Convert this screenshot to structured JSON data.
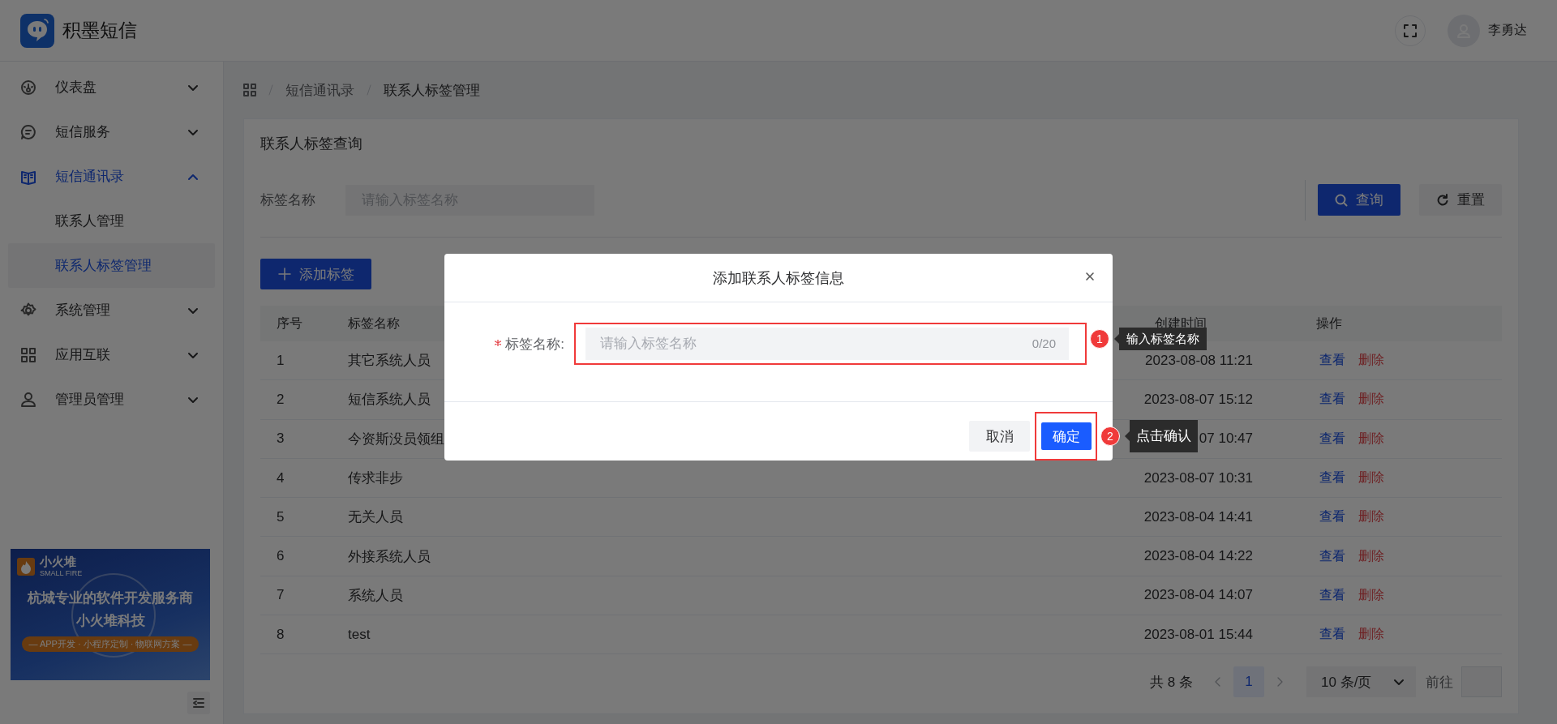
{
  "header": {
    "app_name": "积墨短信",
    "user_name": "李勇达"
  },
  "sidebar": {
    "items": [
      {
        "label": "仪表盘",
        "expanded": false
      },
      {
        "label": "短信服务",
        "expanded": false
      },
      {
        "label": "短信通讯录",
        "expanded": true,
        "children": [
          {
            "label": "联系人管理",
            "selected": false
          },
          {
            "label": "联系人标签管理",
            "selected": true
          }
        ]
      },
      {
        "label": "系统管理",
        "expanded": false
      },
      {
        "label": "应用互联",
        "expanded": false
      },
      {
        "label": "管理员管理",
        "expanded": false
      }
    ],
    "banner": {
      "brand": "小火堆",
      "brand_sub": "SMALL FIRE",
      "headline": "杭城专业的软件开发服务商",
      "company": "小火堆科技",
      "services": "— APP开发 · 小程序定制 · 物联网方案 —"
    }
  },
  "breadcrumb": [
    "短信通讯录",
    "联系人标签管理"
  ],
  "card": {
    "title": "联系人标签查询",
    "search": {
      "label": "标签名称",
      "placeholder": "请输入标签名称"
    },
    "query_button": "查询",
    "reset_button": "重置",
    "add_button": "添加标签"
  },
  "table": {
    "columns": [
      "序号",
      "标签名称",
      "创建时间",
      "操作"
    ],
    "rows": [
      {
        "cells": [
          "1",
          "其它系统人员",
          "2023-08-08 11:21"
        ],
        "actions": [
          "查看",
          "删除"
        ]
      },
      {
        "cells": [
          "2",
          "短信系统人员",
          "2023-08-07 15:12"
        ],
        "actions": [
          "查看",
          "删除"
        ]
      },
      {
        "cells": [
          "3",
          "今资斯没员领组",
          "07 10:47"
        ],
        "actions": [
          "查看",
          "删除"
        ]
      },
      {
        "cells": [
          "4",
          "传求非步",
          "2023-08-07 10:31"
        ],
        "actions": [
          "查看",
          "删除"
        ]
      },
      {
        "cells": [
          "5",
          "无关人员",
          "2023-08-04 14:41"
        ],
        "actions": [
          "查看",
          "删除"
        ]
      },
      {
        "cells": [
          "6",
          "外接系统人员",
          "2023-08-04 14:22"
        ],
        "actions": [
          "查看",
          "删除"
        ]
      },
      {
        "cells": [
          "7",
          "系统人员",
          "2023-08-04 14:07"
        ],
        "actions": [
          "查看",
          "删除"
        ]
      },
      {
        "cells": [
          "8",
          "test",
          "2023-08-01 15:44"
        ],
        "actions": [
          "查看",
          "删除"
        ]
      }
    ]
  },
  "pagination": {
    "total": "共 8 条",
    "pages": [
      {
        "label": "1",
        "selected": true
      }
    ],
    "page_size": "10 条/页",
    "goto_label": "前往"
  },
  "dialog": {
    "title": "添加联系人标签信息",
    "field": {
      "label": "标签名称:",
      "required": true,
      "placeholder": "请输入标签名称",
      "counter": "0/20",
      "annotation": {
        "number": "1",
        "text": "输入标签名称"
      }
    },
    "cancel_button": "取消",
    "confirm_button": {
      "label": "确定",
      "annotation": {
        "number": "2",
        "text": "点击确认"
      }
    }
  }
}
